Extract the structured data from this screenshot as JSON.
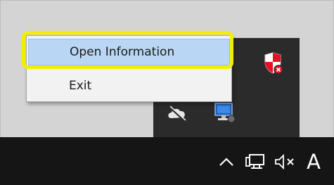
{
  "context_menu": {
    "items": [
      {
        "label": "Open Information",
        "state": "hovered"
      },
      {
        "label": "Exit"
      }
    ]
  },
  "highlight": {
    "color": "#f3ee00"
  },
  "tray_icons": [
    "shield-icon",
    "cloud-icon",
    "monitor-icon"
  ],
  "taskbar": {
    "icons": [
      "chevron-up-icon",
      "network-icon",
      "volume-muted-icon"
    ],
    "ime_indicator": "A"
  },
  "colors": {
    "menu_hover": "#b9d6f4",
    "taskbar": "#151515",
    "flyout": "#2b2b2b",
    "shield_badge": "#e81123"
  }
}
